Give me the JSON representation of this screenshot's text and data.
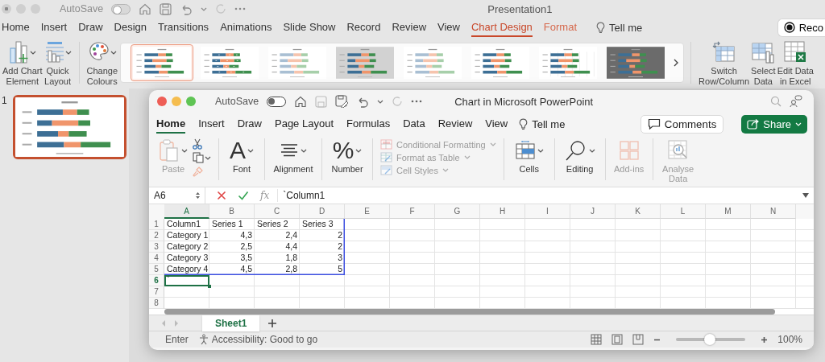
{
  "powerpoint": {
    "autosave": {
      "label": "AutoSave",
      "on": false
    },
    "title": "Presentation1",
    "tabs": [
      {
        "label": "Home",
        "selected": false,
        "kind": "normal"
      },
      {
        "label": "Insert",
        "selected": false,
        "kind": "normal"
      },
      {
        "label": "Draw",
        "selected": false,
        "kind": "normal"
      },
      {
        "label": "Design",
        "selected": false,
        "kind": "normal"
      },
      {
        "label": "Transitions",
        "selected": false,
        "kind": "normal"
      },
      {
        "label": "Animations",
        "selected": false,
        "kind": "normal"
      },
      {
        "label": "Slide Show",
        "selected": false,
        "kind": "normal"
      },
      {
        "label": "Record",
        "selected": false,
        "kind": "normal"
      },
      {
        "label": "Review",
        "selected": false,
        "kind": "normal"
      },
      {
        "label": "View",
        "selected": false,
        "kind": "normal"
      },
      {
        "label": "Chart Design",
        "selected": true,
        "kind": "contextual"
      },
      {
        "label": "Format",
        "selected": false,
        "kind": "contextual"
      }
    ],
    "tell_me": "Tell me",
    "record_button": "Reco",
    "ribbon": {
      "add_chart_element": "Add Chart\nElement",
      "quick_layout": "Quick\nLayout",
      "change_colours": "Change\nColours",
      "style_gallery": [
        {
          "kind": "plain",
          "selected": true
        },
        {
          "kind": "labeled",
          "selected": false
        },
        {
          "kind": "faded",
          "selected": false
        },
        {
          "kind": "shaded",
          "selected": false
        },
        {
          "kind": "faded",
          "selected": false
        },
        {
          "kind": "plain",
          "selected": false
        },
        {
          "kind": "gridded",
          "selected": false
        },
        {
          "kind": "dark",
          "selected": false
        }
      ],
      "switch_row_column": "Switch\nRow/Column",
      "select_data": "Select\nData",
      "edit_data": "Edit Data\nin Excel"
    },
    "slides": [
      {
        "number": "1",
        "selected": true
      }
    ]
  },
  "excel": {
    "autosave": {
      "label": "AutoSave",
      "on": false
    },
    "title": "Chart in Microsoft PowerPoint",
    "tabs": [
      {
        "label": "Home",
        "selected": true
      },
      {
        "label": "Insert",
        "selected": false
      },
      {
        "label": "Draw",
        "selected": false
      },
      {
        "label": "Page Layout",
        "selected": false
      },
      {
        "label": "Formulas",
        "selected": false
      },
      {
        "label": "Data",
        "selected": false
      },
      {
        "label": "Review",
        "selected": false
      },
      {
        "label": "View",
        "selected": false
      }
    ],
    "tell_me": "Tell me",
    "comments_button": "Comments",
    "share_button": "Share",
    "ribbon": {
      "paste": {
        "label": "Paste",
        "disabled": true
      },
      "font_glyph": "A",
      "font": "Font",
      "alignment": "Alignment",
      "number_glyph": "%",
      "number": "Number",
      "styles": [
        {
          "label": "Conditional Formatting",
          "disabled": true
        },
        {
          "label": "Format as Table",
          "disabled": true
        },
        {
          "label": "Cell Styles",
          "disabled": true
        }
      ],
      "cells": "Cells",
      "editing": "Editing",
      "add_ins": {
        "label": "Add-ins",
        "disabled": true
      },
      "analyse_data": {
        "label": "Analyse\nData",
        "disabled": true
      }
    },
    "formula_bar": {
      "name_box": "A6",
      "function_label": "fx",
      "value": "`Column1"
    },
    "sheet": {
      "columns": [
        {
          "label": "A",
          "selected": true,
          "in_chart_range": true
        },
        {
          "label": "B",
          "selected": false,
          "in_chart_range": true
        },
        {
          "label": "C",
          "selected": false,
          "in_chart_range": true
        },
        {
          "label": "D",
          "selected": false,
          "in_chart_range": true
        },
        {
          "label": "E",
          "selected": false,
          "in_chart_range": false
        },
        {
          "label": "F",
          "selected": false,
          "in_chart_range": false
        },
        {
          "label": "G",
          "selected": false,
          "in_chart_range": false
        },
        {
          "label": "H",
          "selected": false,
          "in_chart_range": false
        },
        {
          "label": "I",
          "selected": false,
          "in_chart_range": false
        },
        {
          "label": "J",
          "selected": false,
          "in_chart_range": false
        },
        {
          "label": "K",
          "selected": false,
          "in_chart_range": false
        },
        {
          "label": "L",
          "selected": false,
          "in_chart_range": false
        },
        {
          "label": "M",
          "selected": false,
          "in_chart_range": false
        },
        {
          "label": "N",
          "selected": false,
          "in_chart_range": false
        }
      ],
      "rows": [
        {
          "number": "1",
          "selected": false,
          "in_chart_range": true,
          "cells": [
            {
              "text": "Column1",
              "kind": "text",
              "selected": false
            },
            {
              "text": "Series 1",
              "kind": "text",
              "selected": false
            },
            {
              "text": "Series 2",
              "kind": "text",
              "selected": false
            },
            {
              "text": "Series 3",
              "kind": "text",
              "selected": false
            }
          ]
        },
        {
          "number": "2",
          "selected": false,
          "in_chart_range": true,
          "cells": [
            {
              "text": "Category 1",
              "kind": "text",
              "selected": false
            },
            {
              "text": "4,3",
              "kind": "number",
              "selected": false
            },
            {
              "text": "2,4",
              "kind": "number",
              "selected": false
            },
            {
              "text": "2",
              "kind": "number",
              "selected": false
            }
          ]
        },
        {
          "number": "3",
          "selected": false,
          "in_chart_range": true,
          "cells": [
            {
              "text": "Category 2",
              "kind": "text",
              "selected": false
            },
            {
              "text": "2,5",
              "kind": "number",
              "selected": false
            },
            {
              "text": "4,4",
              "kind": "number",
              "selected": false
            },
            {
              "text": "2",
              "kind": "number",
              "selected": false
            }
          ]
        },
        {
          "number": "4",
          "selected": false,
          "in_chart_range": true,
          "cells": [
            {
              "text": "Category 3",
              "kind": "text",
              "selected": false
            },
            {
              "text": "3,5",
              "kind": "number",
              "selected": false
            },
            {
              "text": "1,8",
              "kind": "number",
              "selected": false
            },
            {
              "text": "3",
              "kind": "number",
              "selected": false
            }
          ]
        },
        {
          "number": "5",
          "selected": false,
          "in_chart_range": true,
          "cells": [
            {
              "text": "Category 4",
              "kind": "text",
              "selected": false
            },
            {
              "text": "4,5",
              "kind": "number",
              "selected": false
            },
            {
              "text": "2,8",
              "kind": "number",
              "selected": false
            },
            {
              "text": "5",
              "kind": "number",
              "selected": false
            }
          ]
        },
        {
          "number": "6",
          "selected": true,
          "in_chart_range": false,
          "cells": [
            {
              "text": "`",
              "kind": "text",
              "selected": true
            }
          ]
        },
        {
          "number": "7",
          "selected": false,
          "in_chart_range": false
        },
        {
          "number": "8",
          "selected": false,
          "in_chart_range": false
        }
      ]
    },
    "sheet_tabs": [
      {
        "label": "Sheet1",
        "selected": true
      }
    ],
    "status_bar": {
      "mode": "Enter",
      "accessibility": "Accessibility: Good to go",
      "zoom": {
        "level": 0.48
      },
      "zoom_label": "100%"
    }
  }
}
